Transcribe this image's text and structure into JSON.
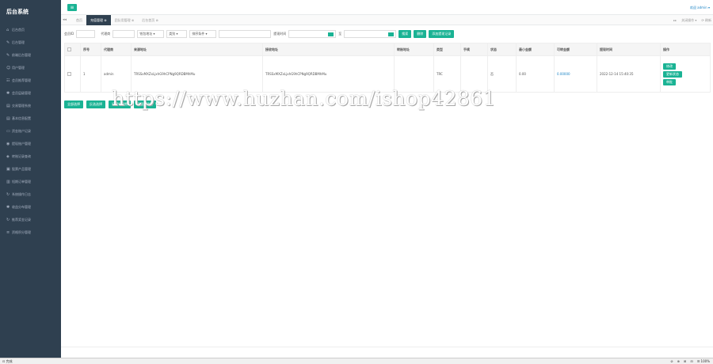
{
  "app": {
    "brand": "后台系统"
  },
  "sidebar": {
    "items": [
      {
        "icon": "home-icon",
        "glyph": "⌂",
        "label": "后台首页"
      },
      {
        "icon": "wrench-icon",
        "glyph": "✎",
        "label": "后台管理"
      },
      {
        "icon": "tool-icon",
        "glyph": "✎",
        "label": "前端后台管理"
      },
      {
        "icon": "user-icon",
        "glyph": "☺",
        "label": "用户管理"
      },
      {
        "icon": "users-icon",
        "glyph": "☷",
        "label": "会员推荐管理"
      },
      {
        "icon": "gear-icon",
        "glyph": "✱",
        "label": "会员层级管理"
      },
      {
        "icon": "doc-icon",
        "glyph": "▤",
        "label": "交易管理系统"
      },
      {
        "icon": "doc-icon",
        "glyph": "▤",
        "label": "基本信息配置"
      },
      {
        "icon": "card-icon",
        "glyph": "▭",
        "label": "资金账户记录"
      },
      {
        "icon": "chat-icon",
        "glyph": "◉",
        "label": "提现账户管理"
      },
      {
        "icon": "car-icon",
        "glyph": "◈",
        "label": "转账记录查询"
      },
      {
        "icon": "box-icon",
        "glyph": "▣",
        "label": "股票产品管理"
      },
      {
        "icon": "chart-icon",
        "glyph": "▥",
        "label": "短期订单管理"
      },
      {
        "icon": "refresh-icon",
        "glyph": "↻",
        "label": "系统操作日志"
      },
      {
        "icon": "gear-icon",
        "glyph": "✱",
        "label": "收益分布管理"
      },
      {
        "icon": "refresh-icon",
        "glyph": "↻",
        "label": "推荐奖金记录"
      },
      {
        "icon": "list-icon",
        "glyph": "≡",
        "label": "资格积分管理"
      }
    ]
  },
  "topbar": {
    "menu_glyph": "≡",
    "welcome": "欢迎 admin ▾"
  },
  "tabs": {
    "prev": "◂◂",
    "items": [
      {
        "label": "首页",
        "active": false
      },
      {
        "label": "充值管理 ⊗",
        "active": true
      },
      {
        "label": "团队用管理 ⊗",
        "active": false
      },
      {
        "label": "后台首页 ⊗",
        "active": false
      }
    ],
    "next": "▸▸",
    "close_ops": "关闭操作 ▾",
    "refresh": "⟳ 刷新"
  },
  "filters": {
    "user_label": "会员ID",
    "user_placeholder": "",
    "agent_label": "代理商",
    "agent_placeholder": "",
    "address_select": "钱包地址 ▾",
    "type_select": "类别 ▾",
    "order_select": "排序条件 ▾",
    "date_label": "提现时间",
    "date_sep": "至",
    "search": "搜索",
    "delete": "删除",
    "add": "添加提现记录"
  },
  "table": {
    "headers": [
      "",
      "序号",
      "代理商",
      "来源地址",
      "接收地址",
      "转账地址",
      "类型",
      "手续",
      "状态",
      "最小金额",
      "可转金额",
      "提现时间",
      "操作"
    ],
    "rows": [
      {
        "index": "1",
        "agent": "admin",
        "from": "TRSSxMXZxLjxhG9hCPNg9QRDBMhMu",
        "to": "TRSSxMXZxLjxhG9hCPNg9QRDBMhMu",
        "transfer": "",
        "type": "TRC",
        "fee": "",
        "status": "否",
        "min_amount": "0.00",
        "amount": "0.00000",
        "time": "2022-12-14 15:40:35",
        "ops": [
          "修改",
          "更新状态",
          "审批"
        ]
      }
    ]
  },
  "bulk": {
    "buttons": [
      "全部选择",
      "反选选择",
      "设置有效期",
      "批量删除数"
    ]
  },
  "watermark": "https://www.huzhan.com/ishop42861",
  "statusbar": {
    "left": "⊡ 完成",
    "right": [
      "⊘",
      "⊕",
      "⊞",
      "⊟",
      "☰ 100%"
    ]
  },
  "colors": {
    "accent": "#1ab394",
    "sidebar": "#2f4050",
    "link": "#1c84c6"
  }
}
